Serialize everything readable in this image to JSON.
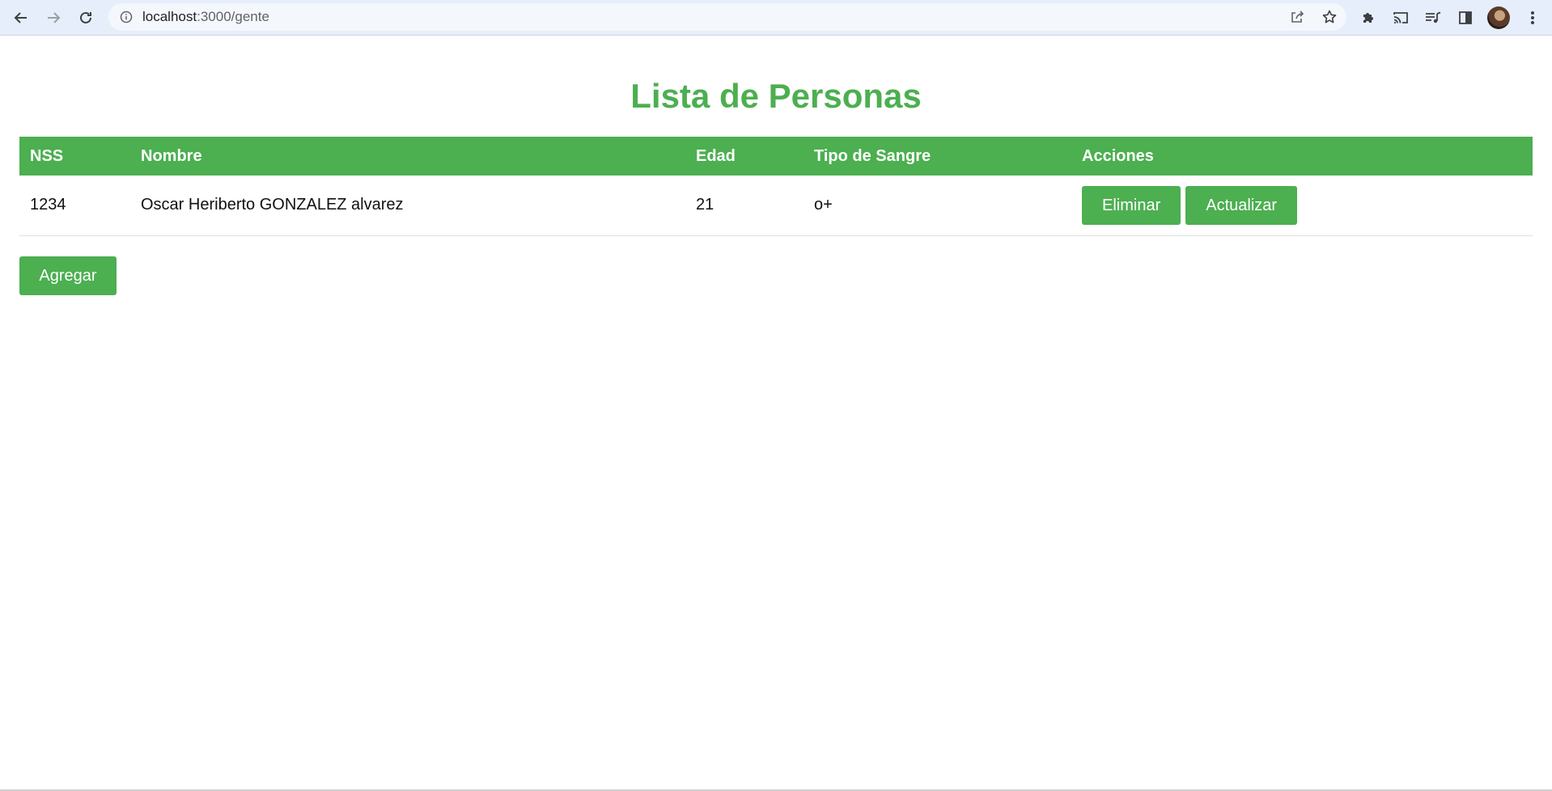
{
  "browser": {
    "url_host": "localhost",
    "url_path": ":3000/gente"
  },
  "page": {
    "title": "Lista de Personas",
    "table": {
      "headers": [
        "NSS",
        "Nombre",
        "Edad",
        "Tipo de Sangre",
        "Acciones"
      ],
      "rows": [
        {
          "nss": "1234",
          "nombre": "Oscar Heriberto GONZALEZ alvarez",
          "edad": "21",
          "tipo_sangre": "o+",
          "actions": {
            "delete_label": "Eliminar",
            "update_label": "Actualizar"
          }
        }
      ]
    },
    "add_label": "Agregar"
  },
  "colors": {
    "accent": "#4caf50"
  }
}
